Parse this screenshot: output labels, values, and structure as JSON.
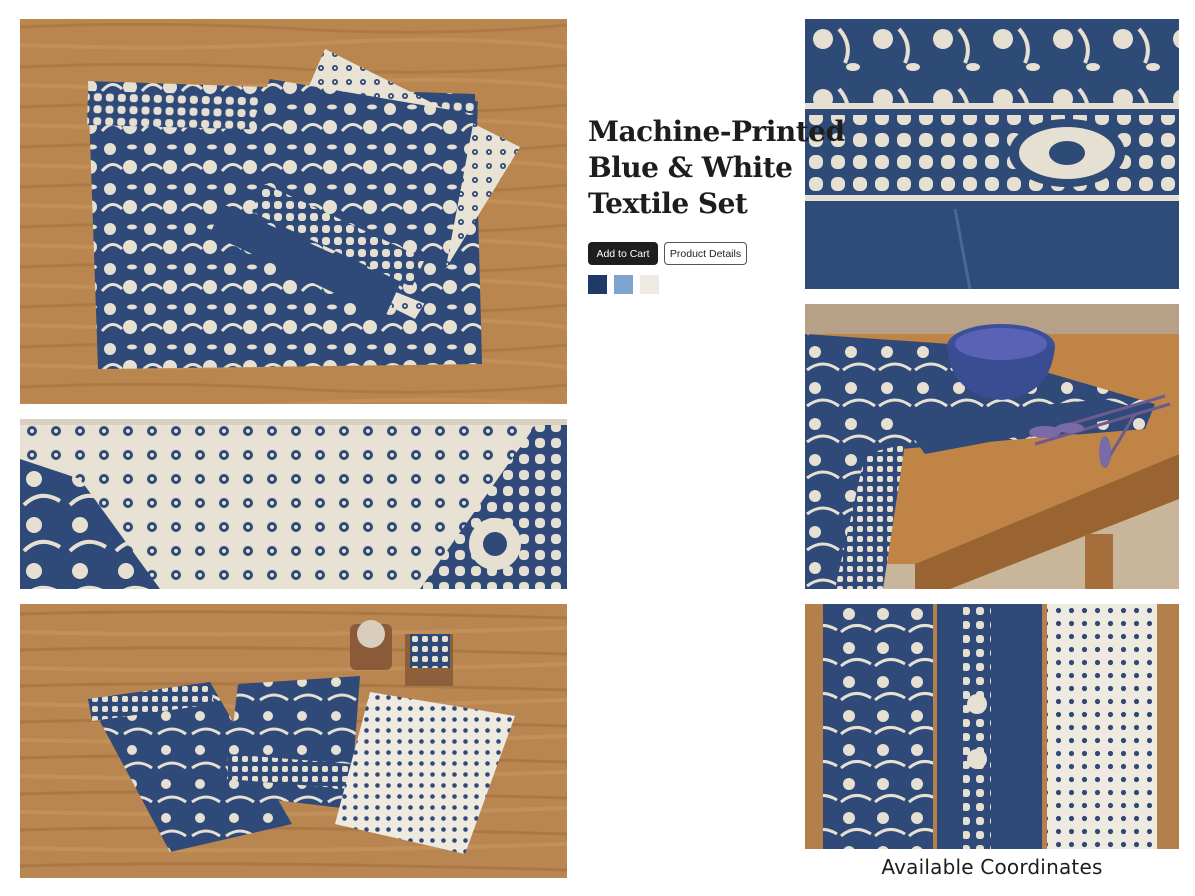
{
  "product": {
    "title_lines": [
      "Machine-Printed",
      "Blue & White",
      "Textile Set"
    ],
    "add_to_cart_label": "Add to Cart",
    "details_label": "Product Details"
  },
  "swatches": [
    {
      "name": "navy",
      "color": "#1f3a66"
    },
    {
      "name": "light-blue",
      "color": "#7ea3cf"
    },
    {
      "name": "cream",
      "color": "#eeeae1"
    }
  ],
  "coordinates_caption": "Available Coordinates",
  "colors": {
    "indigo": "#2f4a78",
    "cream": "#e9e3d6",
    "wood": "#b8864e"
  }
}
